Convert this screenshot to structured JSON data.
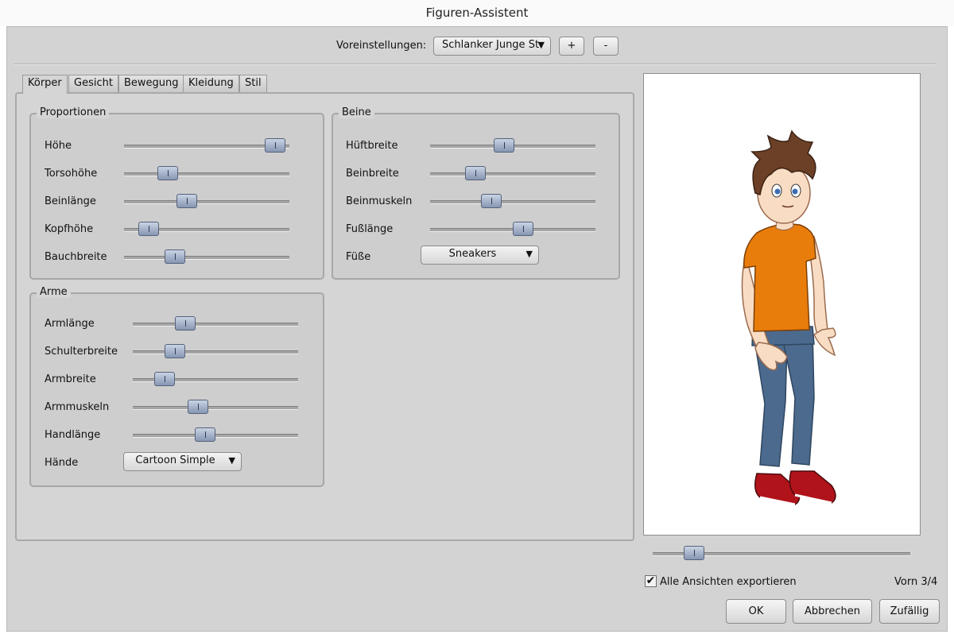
{
  "window": {
    "title": "Figuren-Assistent"
  },
  "presets": {
    "label": "Voreinstellungen:",
    "selected": "Schlanker Junge St",
    "add_label": "+",
    "remove_label": "-"
  },
  "tabs": [
    "Körper",
    "Gesicht",
    "Bewegung",
    "Kleidung",
    "Stil"
  ],
  "proportionen": {
    "title": "Proportionen",
    "sliders": [
      {
        "label": "Höhe",
        "value": 0.97
      },
      {
        "label": "Torsohöhe",
        "value": 0.23
      },
      {
        "label": "Beinlänge",
        "value": 0.36
      },
      {
        "label": "Kopfhöhe",
        "value": 0.1
      },
      {
        "label": "Bauchbreite",
        "value": 0.28
      }
    ]
  },
  "beine": {
    "title": "Beine",
    "sliders": [
      {
        "label": "Hüftbreite",
        "value": 0.44
      },
      {
        "label": "Beinbreite",
        "value": 0.24
      },
      {
        "label": "Beinmuskeln",
        "value": 0.35
      },
      {
        "label": "Fußlänge",
        "value": 0.57
      }
    ],
    "feet_label": "Füße",
    "feet_value": "Sneakers"
  },
  "arme": {
    "title": "Arme",
    "sliders": [
      {
        "label": "Armlänge",
        "value": 0.29
      },
      {
        "label": "Schulterbreite",
        "value": 0.22
      },
      {
        "label": "Armbreite",
        "value": 0.15
      },
      {
        "label": "Armmuskeln",
        "value": 0.38
      },
      {
        "label": "Handlänge",
        "value": 0.43
      }
    ],
    "hands_label": "Hände",
    "hands_value": "Cartoon Simple"
  },
  "view": {
    "slider_value": 0.13,
    "export_all_label": "Alle Ansichten exportieren",
    "export_all_checked": true,
    "view_label": "Vorn 3/4"
  },
  "buttons": {
    "ok": "OK",
    "cancel": "Abbrechen",
    "random": "Zufällig"
  },
  "colors": {
    "shirt": "#e97d0c",
    "pants": "#4b6a8d",
    "hair": "#6b4027",
    "shoes": "#b1131b",
    "skin": "#f8ddc4"
  }
}
